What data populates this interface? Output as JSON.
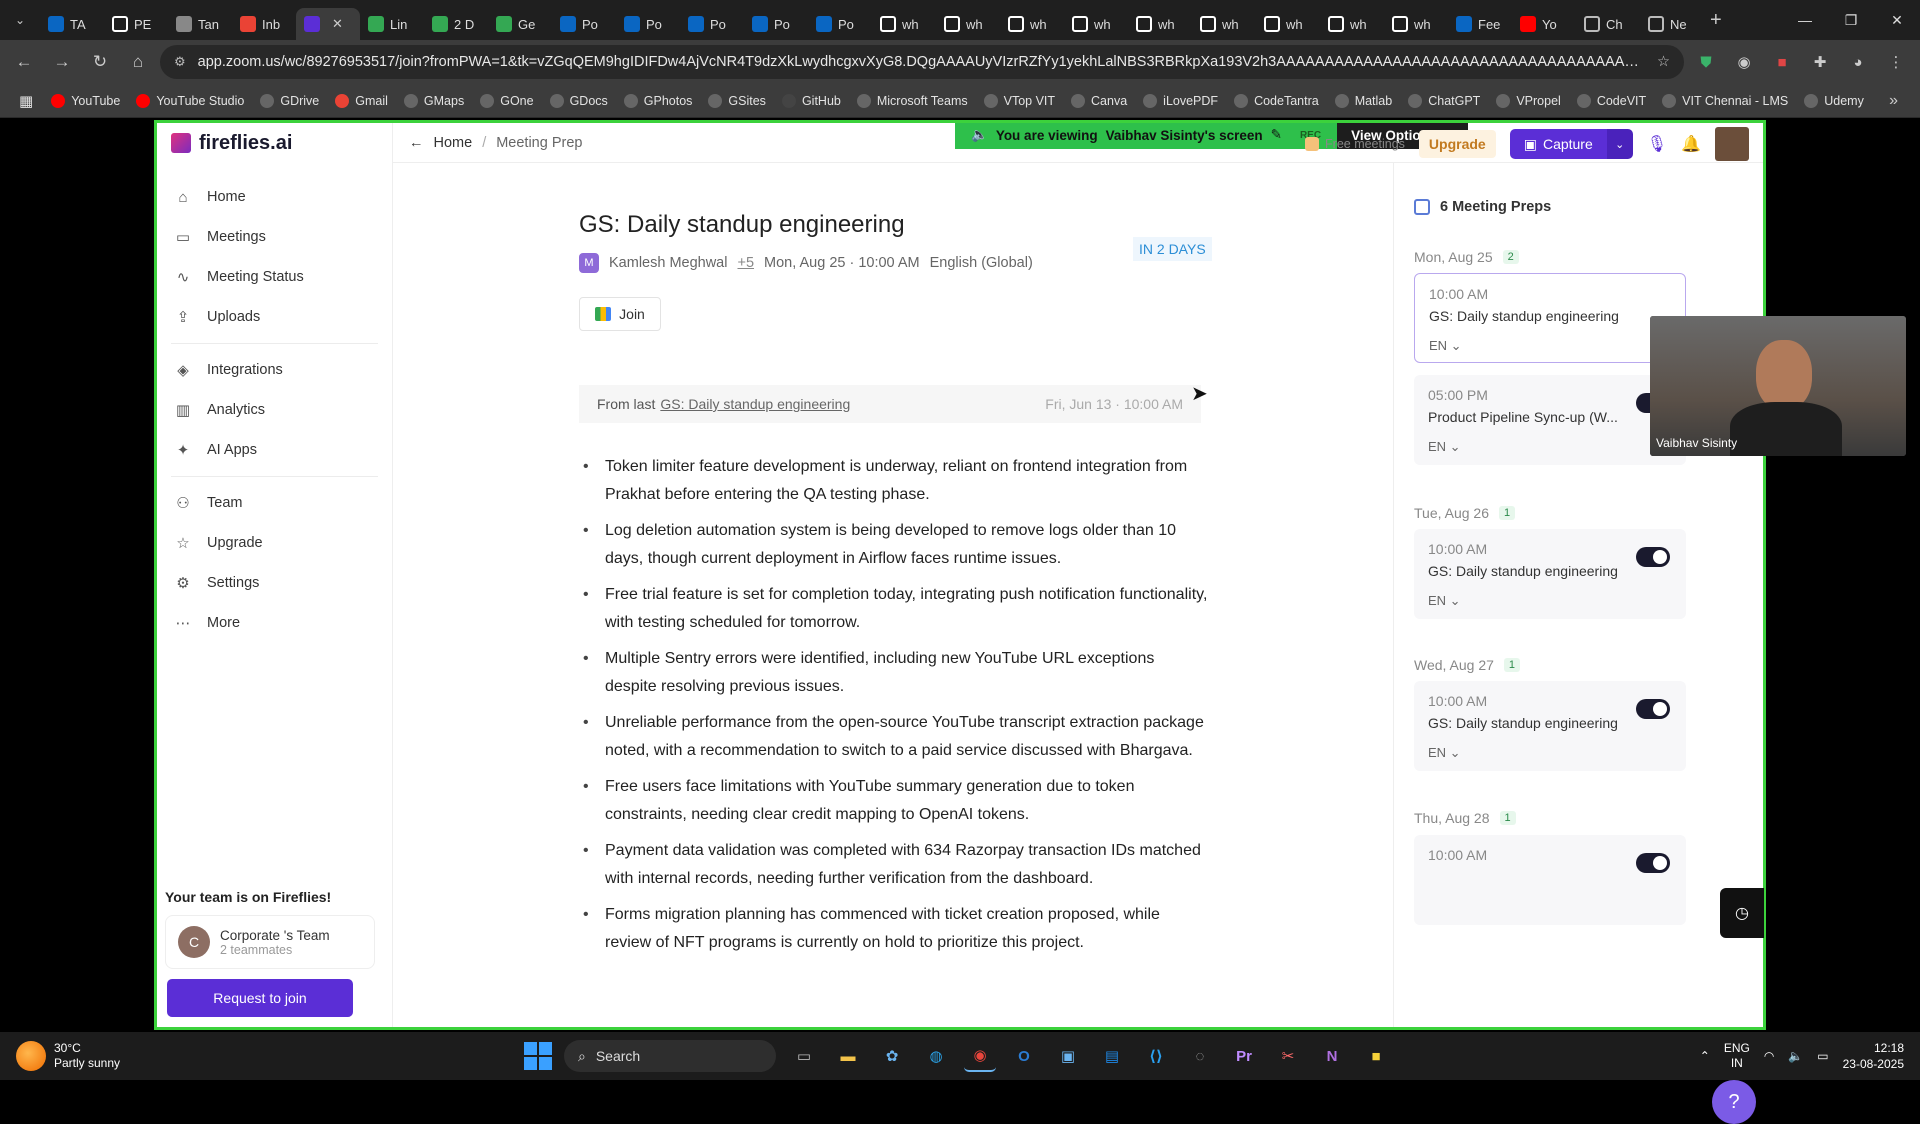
{
  "browser": {
    "tabs": [
      {
        "label": "TA",
        "color": "#0a66c2",
        "icon": "linkedin-icon"
      },
      {
        "label": "PE",
        "color": "#ffffff",
        "icon": "github-icon"
      },
      {
        "label": "Tan",
        "color": "#888888",
        "icon": "globe-icon"
      },
      {
        "label": "Inb",
        "color": "#ea4335",
        "icon": "gmail-icon"
      },
      {
        "label": "",
        "color": "#5b2ed6",
        "icon": "speaker-icon",
        "active": true
      },
      {
        "label": "Lin",
        "color": "#34a853",
        "icon": "dots-icon"
      },
      {
        "label": "2 D",
        "color": "#34a853",
        "icon": "sheets-icon"
      },
      {
        "label": "Ge",
        "color": "#34a853",
        "icon": "sheets-icon"
      },
      {
        "label": "Po",
        "color": "#0a66c2",
        "icon": "linkedin-icon"
      },
      {
        "label": "Po",
        "color": "#0a66c2",
        "icon": "linkedin-icon"
      },
      {
        "label": "Po",
        "color": "#0a66c2",
        "icon": "linkedin-icon"
      },
      {
        "label": "Po",
        "color": "#0a66c2",
        "icon": "linkedin-icon"
      },
      {
        "label": "Po",
        "color": "#0a66c2",
        "icon": "linkedin-icon"
      },
      {
        "label": "wh",
        "color": "#ffffff",
        "icon": "google-icon"
      },
      {
        "label": "wh",
        "color": "#ffffff",
        "icon": "google-icon"
      },
      {
        "label": "wh",
        "color": "#ffffff",
        "icon": "google-icon"
      },
      {
        "label": "wh",
        "color": "#ffffff",
        "icon": "google-icon"
      },
      {
        "label": "wh",
        "color": "#ffffff",
        "icon": "google-icon"
      },
      {
        "label": "wh",
        "color": "#ffffff",
        "icon": "google-icon"
      },
      {
        "label": "wh",
        "color": "#ffffff",
        "icon": "google-icon"
      },
      {
        "label": "wh",
        "color": "#ffffff",
        "icon": "google-icon"
      },
      {
        "label": "wh",
        "color": "#ffffff",
        "icon": "google-icon"
      },
      {
        "label": "Fee",
        "color": "#0a66c2",
        "icon": "linkedin-icon"
      },
      {
        "label": "Yo",
        "color": "#ff0000",
        "icon": "youtube-icon"
      },
      {
        "label": "Ch",
        "color": "#bbbbbb",
        "icon": "chatgpt-icon"
      },
      {
        "label": "Ne",
        "color": "#bbbbbb",
        "icon": "chatgpt-icon"
      }
    ],
    "url": "app.zoom.us/wc/89276953517/join?fromPWA=1&tk=vZGqQEM9hgIDIFDw4AjVcNR4T9dzXkLwydhcgxvXyG8.DQgAAAAUyVIzrRZfYy1yekhLalNBS3RBRkpXa193V2h3AAAAAAAAAAAAAAAAAAAAAAAAAAAAAAAAAAAAAAAAAAAAAAAA&_x_zm_r...",
    "bookmarks": [
      {
        "label": "YouTube",
        "color": "#ff0000"
      },
      {
        "label": "YouTube Studio",
        "color": "#ff0000"
      },
      {
        "label": "GDrive",
        "color": "#666666"
      },
      {
        "label": "Gmail",
        "color": "#ea4335"
      },
      {
        "label": "GMaps",
        "color": "#666666"
      },
      {
        "label": "GOne",
        "color": "#666666"
      },
      {
        "label": "GDocs",
        "color": "#666666"
      },
      {
        "label": "GPhotos",
        "color": "#666666"
      },
      {
        "label": "GSites",
        "color": "#666666"
      },
      {
        "label": "GitHub",
        "color": "#444444"
      },
      {
        "label": "Microsoft Teams",
        "color": "#666666"
      },
      {
        "label": "VTop VIT",
        "color": "#666666"
      },
      {
        "label": "Canva",
        "color": "#666666"
      },
      {
        "label": "iLovePDF",
        "color": "#666666"
      },
      {
        "label": "CodeTantra",
        "color": "#666666"
      },
      {
        "label": "Matlab",
        "color": "#666666"
      },
      {
        "label": "ChatGPT",
        "color": "#666666"
      },
      {
        "label": "VPropel",
        "color": "#666666"
      },
      {
        "label": "CodeVIT",
        "color": "#666666"
      },
      {
        "label": "VIT Chennai - LMS",
        "color": "#666666"
      },
      {
        "label": "Udemy",
        "color": "#666666"
      }
    ]
  },
  "zoom": {
    "viewing_text": "You are viewing",
    "viewing_name": "Vaibhav Sisinty's screen",
    "rec": "REC",
    "view_options": "View Options",
    "participant_name": "Vaibhav Sisinty"
  },
  "app": {
    "logo": "fireflies.ai",
    "nav": [
      {
        "label": "Home",
        "icon": "home-icon",
        "glyph": "⌂"
      },
      {
        "label": "Meetings",
        "icon": "video-icon",
        "glyph": "▭"
      },
      {
        "label": "Meeting Status",
        "icon": "activity-icon",
        "glyph": "∿"
      },
      {
        "label": "Uploads",
        "icon": "upload-icon",
        "glyph": "⇪"
      },
      {
        "label": "Integrations",
        "icon": "layers-icon",
        "glyph": "◈"
      },
      {
        "label": "Analytics",
        "icon": "bar-chart-icon",
        "glyph": "▥"
      },
      {
        "label": "AI Apps",
        "icon": "sparkle-icon",
        "glyph": "✦"
      },
      {
        "label": "Team",
        "icon": "users-icon",
        "glyph": "⚇"
      },
      {
        "label": "Upgrade",
        "icon": "star-icon",
        "glyph": "☆"
      },
      {
        "label": "Settings",
        "icon": "gear-icon",
        "glyph": "⚙"
      },
      {
        "label": "More",
        "icon": "more-icon",
        "glyph": "⋯"
      }
    ],
    "team": {
      "title": "Your team is on Fireflies!",
      "avatar_letter": "C",
      "name": "Corporate 's Team",
      "members": "2 teammates",
      "button": "Request to join"
    },
    "breadcrumb": {
      "home": "Home",
      "current": "Meeting Prep"
    },
    "top": {
      "free": "Free meetings",
      "upgrade": "Upgrade",
      "capture": "Capture"
    },
    "meeting": {
      "title": "GS: Daily standup engineering",
      "avatar_letter": "M",
      "host": "Kamlesh Meghwal",
      "plus": "+5",
      "datetime": "Mon, Aug 25 · 10:00 AM",
      "language": "English (Global)",
      "badge": "IN 2 DAYS",
      "join": "Join",
      "from_last_prefix": "From last",
      "from_last_link": "GS: Daily standup engineering",
      "from_last_date": "Fri, Jun 13 · 10:00 AM",
      "bullets": [
        "Token limiter feature development is underway, reliant on frontend integration from Prakhat before entering the QA testing phase.",
        "Log deletion automation system is being developed to remove logs older than 10 days, though current deployment in Airflow faces runtime issues.",
        "Free trial feature is set for completion today, integrating push notification functionality, with testing scheduled for tomorrow.",
        "Multiple Sentry errors were identified, including new YouTube URL exceptions despite resolving previous issues.",
        "Unreliable performance from the open-source YouTube transcript extraction package noted, with a recommendation to switch to a paid service discussed with Bhargava.",
        "Free users face limitations with YouTube summary generation due to token constraints, needing clear credit mapping to OpenAI tokens.",
        "Payment data validation was completed with 634 Razorpay transaction IDs matched with internal records, needing further verification from the dashboard.",
        "Forms migration planning has commenced with ticket creation proposed, while review of NFT programs is currently on hold to prioritize this project."
      ]
    },
    "preps": {
      "title": "6 Meeting Preps",
      "days": [
        {
          "label": "Mon, Aug 25",
          "count": "2"
        },
        {
          "label": "Tue, Aug 26",
          "count": "1"
        },
        {
          "label": "Wed, Aug 27",
          "count": "1"
        },
        {
          "label": "Thu, Aug 28",
          "count": "1"
        }
      ],
      "cards": [
        {
          "time": "10:00 AM",
          "name": "GS: Daily standup engineering",
          "lang": "EN ⌄"
        },
        {
          "time": "05:00 PM",
          "name": "Product Pipeline Sync-up (W...",
          "lang": "EN ⌄"
        },
        {
          "time": "10:00 AM",
          "name": "GS: Daily standup engineering",
          "lang": "EN ⌄"
        },
        {
          "time": "10:00 AM",
          "name": "GS: Daily standup engineering",
          "lang": "EN ⌄"
        },
        {
          "time": "10:00 AM",
          "name": "",
          "lang": ""
        }
      ]
    }
  },
  "taskbar": {
    "temp": "30°C",
    "weather": "Partly sunny",
    "search": "Search",
    "lang1": "ENG",
    "lang2": "IN",
    "time": "12:18",
    "date": "23-08-2025"
  }
}
